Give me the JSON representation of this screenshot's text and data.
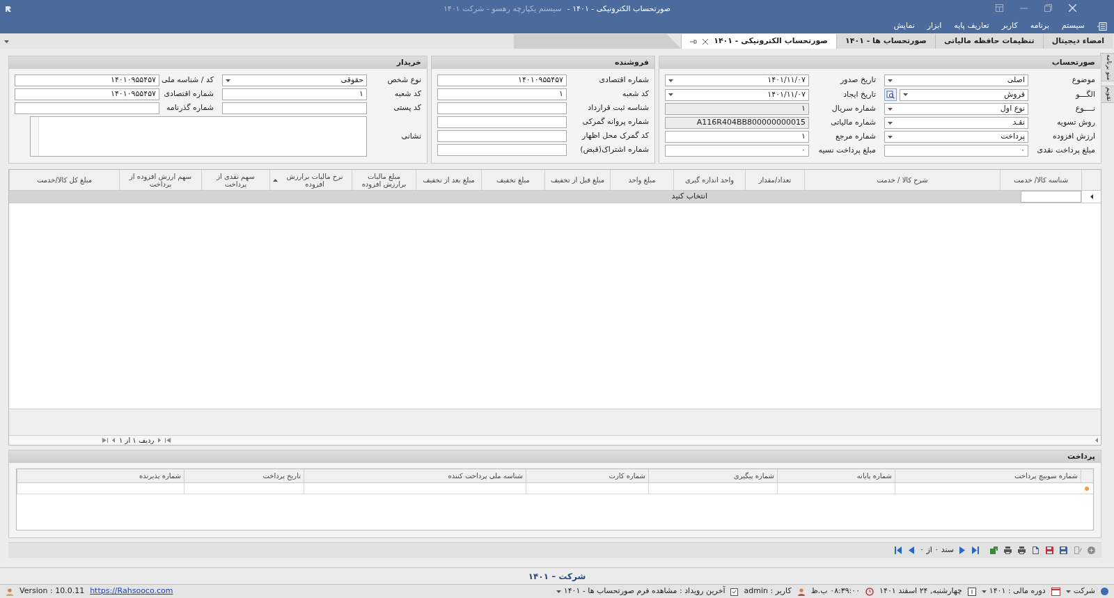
{
  "window": {
    "title": "صورتحساب الکترونیکی - ۱۴۰۱ -",
    "subtitle": "سیستم یکپارچه رهسو - شرکت ۱۴۰۱"
  },
  "menu": [
    "سیستم",
    "برنامه",
    "کاربر",
    "تعاریف پایه",
    "ابزار",
    "نمایش"
  ],
  "tabs": [
    {
      "label": "امضاء دیجیتال",
      "selected": false
    },
    {
      "label": "تنظیمات حافظه مالیاتی",
      "selected": false
    },
    {
      "label": "صورتحساب ها - ۱۴۰۱",
      "selected": false
    },
    {
      "label": "صورتحساب الکترونیکی - ۱۴۰۱",
      "selected": true
    }
  ],
  "side_tabs": [
    "منو برنامه",
    "تقویم"
  ],
  "invoice": {
    "title": "صورتحساب",
    "fields": [
      {
        "label": "موضوع",
        "value": "اصلی",
        "kind": "combo"
      },
      {
        "label": "تاریخ صدور",
        "value": "۱۴۰۱/۱۱/۰۷",
        "kind": "combo"
      },
      {
        "label": "الگـــو",
        "value": "فروش",
        "kind": "lookup"
      },
      {
        "label": "تاریخ ایجاد",
        "value": "۱۴۰۱/۱۱/۰۷",
        "kind": "combo"
      },
      {
        "label": "نــــوع",
        "value": "نوع اول",
        "kind": "combo"
      },
      {
        "label": "شماره سریال",
        "value": "۱",
        "kind": "readonly"
      },
      {
        "label": "روش تسویه",
        "value": "نقـد",
        "kind": "combo"
      },
      {
        "label": "شماره مالیاتی",
        "value": "A116R404BB800000000015",
        "kind": "readonly"
      },
      {
        "label": "ارزش افزوده",
        "value": "پرداخت",
        "kind": "combo"
      },
      {
        "label": "شماره مرجع",
        "value": "۱",
        "kind": "text"
      },
      {
        "label": "مبلغ پرداخت نقدی",
        "value": "۰",
        "kind": "text"
      },
      {
        "label": "مبلغ پرداخت نسیه",
        "value": "۰",
        "kind": "text"
      }
    ]
  },
  "seller": {
    "title": "فروشنده",
    "fields": [
      {
        "label": "شماره اقتصادی",
        "value": "۱۴۰۱۰۹۵۵۴۵۷",
        "kind": "text"
      },
      {
        "label": "کد شعبه",
        "value": "۱",
        "kind": "text"
      },
      {
        "label": "شناسه ثبت قرارداد",
        "kind": "text"
      },
      {
        "label": "شماره پروانه گمرکی",
        "kind": "text"
      },
      {
        "label": "کد گمرک محل اظهار",
        "kind": "text"
      },
      {
        "label": "شماره اشتراک(قبض)",
        "kind": "text"
      }
    ]
  },
  "buyer": {
    "title": "خریدار",
    "fields": [
      {
        "label": "نوع شخص",
        "value": "حقوقی",
        "kind": "combo"
      },
      {
        "label": "کد / شناسه ملی",
        "value": "۱۴۰۱۰۹۵۵۴۵۷",
        "kind": "text"
      },
      {
        "label": "کد شعبه",
        "value": "۱",
        "kind": "text"
      },
      {
        "label": "شماره اقتصادی",
        "value": "۱۴۰۱۰۹۵۵۴۵۷",
        "kind": "text"
      },
      {
        "label": "کد پستی",
        "kind": "text"
      },
      {
        "label": "شماره گذرنامه",
        "kind": "text"
      }
    ],
    "address": {
      "label": "نشانی"
    }
  },
  "items_table": {
    "columns": [
      {
        "label": "شناسه کالا/ خدمت"
      },
      {
        "label": "شرح کالا / خدمت"
      },
      {
        "label": "تعداد/مقدار"
      },
      {
        "label": "واحد اندازه گیری"
      },
      {
        "label": "مبلغ واحد"
      },
      {
        "label": "مبلغ قبل از تخفیف"
      },
      {
        "label": "مبلغ تخفیف"
      },
      {
        "label": "مبلغ بعد از تخفیف"
      },
      {
        "label": "مبلغ مالیات برارزش افزوده"
      },
      {
        "label": "نرخ مالیات برارزش افزوده",
        "sorted": true
      },
      {
        "label": "سهم نقدی از پرداخت"
      },
      {
        "label": "سهم ارزش افزوده از پرداخت"
      },
      {
        "label": "مبلغ کل کالا/خدمت"
      }
    ],
    "new_row_prompt": "انتخاب کنید",
    "navigator": "ردیف ۱ از ۱"
  },
  "payment": {
    "title": "پرداخت",
    "columns": [
      "شماره سوییچ پرداخت",
      "شماره پایانه",
      "شماره پیگیری",
      "شماره کارت",
      "شناسه ملی پرداخت کننده",
      "تاریخ پرداخت",
      "شماره پذیرنده"
    ]
  },
  "toolbar": {
    "record": "سند ۰ از ۰"
  },
  "footer": "شرکت – ۱۴۰۱",
  "status_bar": {
    "company": "شرکت",
    "fiscal_year": "دوره مالی : ۱۴۰۱",
    "date": "چهارشنبه, ۲۴ اسفند ۱۴۰۱",
    "time": "۰۸:۳۹:۰۰ ب.ظ",
    "user": "کاربر : admin",
    "last_event": "آخرین رویداد :  مشاهده فرم صورتحساب ها - ۱۴۰۱",
    "link": "https://Rahsooco.com",
    "version": "Version : 10.0.11"
  }
}
